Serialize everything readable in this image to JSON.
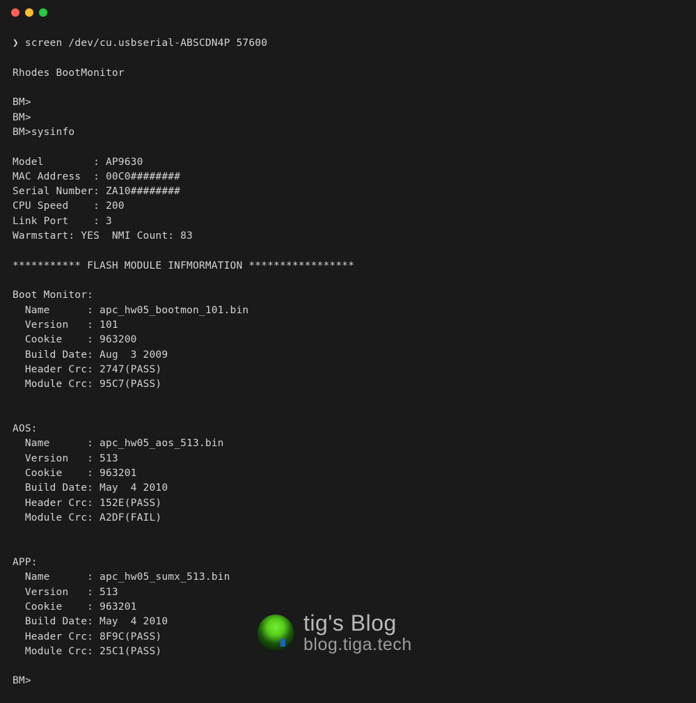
{
  "window": {
    "close_color": "#ff5f56",
    "min_color": "#ffbd2e",
    "max_color": "#27c93f"
  },
  "terminal": {
    "prompt_char": "❯",
    "command": "screen /dev/cu.usbserial-ABSCDN4P 57600",
    "header_line": "Rhodes BootMonitor",
    "bm_prompt": "BM>",
    "sysinfo_cmd": "sysinfo",
    "sysinfo": {
      "model_line": "Model        : AP9630",
      "mac_line": "MAC Address  : 00C0########",
      "serial_line": "Serial Number: ZA10########",
      "cpu_line": "CPU Speed    : 200",
      "link_line": "Link Port    : 3",
      "warm_line": "Warmstart: YES  NMI Count: 83"
    },
    "flash_header": "*********** FLASH MODULE INFMORMATION *****************",
    "boot_monitor": {
      "title": "Boot Monitor:",
      "name": "  Name      : apc_hw05_bootmon_101.bin",
      "version": "  Version   : 101",
      "cookie": "  Cookie    : 963200",
      "build": "  Build Date: Aug  3 2009",
      "header_crc": "  Header Crc: 2747(PASS)",
      "module_crc": "  Module Crc: 95C7(PASS)"
    },
    "aos": {
      "title": "AOS:",
      "name": "  Name      : apc_hw05_aos_513.bin",
      "version": "  Version   : 513",
      "cookie": "  Cookie    : 963201",
      "build": "  Build Date: May  4 2010",
      "header_crc": "  Header Crc: 152E(PASS)",
      "module_crc": "  Module Crc: A2DF(FAIL)"
    },
    "app": {
      "title": "APP:",
      "name": "  Name      : apc_hw05_sumx_513.bin",
      "version": "  Version   : 513",
      "cookie": "  Cookie    : 963201",
      "build": "  Build Date: May  4 2010",
      "header_crc": "  Header Crc: 8F9C(PASS)",
      "module_crc": "  Module Crc: 25C1(PASS)"
    }
  },
  "watermark": {
    "title": "tig's Blog",
    "subtitle": "blog.tiga.tech"
  }
}
